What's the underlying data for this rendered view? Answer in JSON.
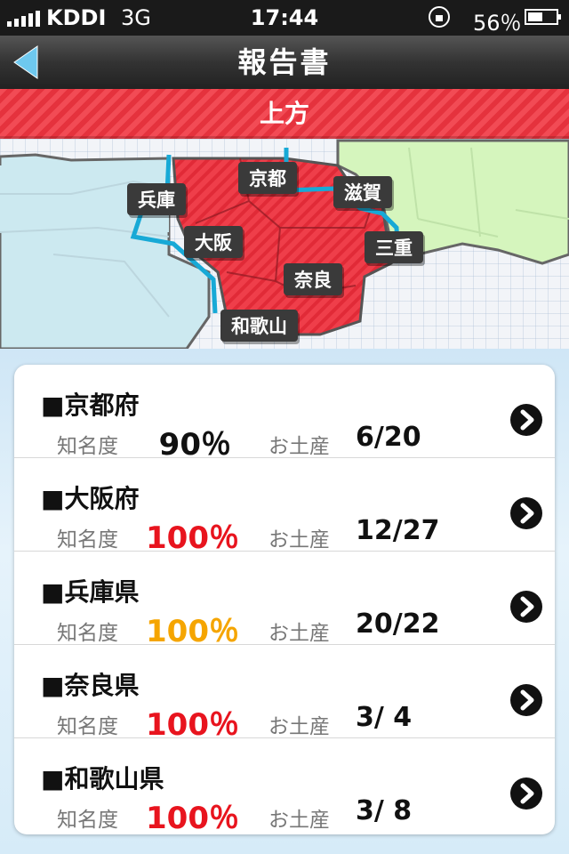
{
  "status_bar": {
    "carrier": "KDDI",
    "network": "3G",
    "time": "17:44",
    "battery": "56％",
    "battery_level": 0.56
  },
  "nav": {
    "title": "報告書"
  },
  "region": {
    "title": "上方"
  },
  "map_labels": {
    "kyoto": "京都",
    "hyogo": "兵庫",
    "shiga": "滋賀",
    "osaka": "大阪",
    "mie": "三重",
    "nara": "奈良",
    "wakayama": "和歌山"
  },
  "list": {
    "fame_label": "知名度",
    "souvenir_label": "お土産",
    "rows": [
      {
        "name": "■京都府",
        "fame": "90％",
        "fame_color": "#111111",
        "souvenir": "6/20"
      },
      {
        "name": "■大阪府",
        "fame": "100％",
        "fame_color": "#e8141e",
        "souvenir": "12/27"
      },
      {
        "name": "■兵庫県",
        "fame": "100％",
        "fame_color": "#f5a500",
        "souvenir": "20/22"
      },
      {
        "name": "■奈良県",
        "fame": "100％",
        "fame_color": "#e8141e",
        "souvenir": "3/ 4"
      },
      {
        "name": "■和歌山県",
        "fame": "100％",
        "fame_color": "#e8141e",
        "souvenir": "3/ 8"
      }
    ]
  },
  "icons": {
    "back": "back-arrow-icon",
    "row_action": "chevron-right-icon"
  }
}
